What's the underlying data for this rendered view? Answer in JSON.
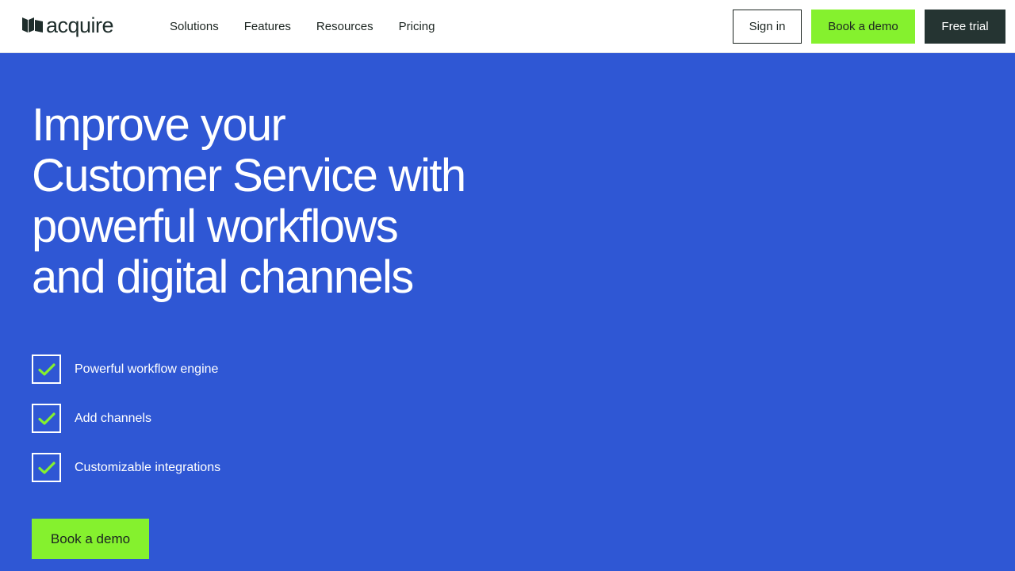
{
  "brand": {
    "name": "acquire",
    "logo_icon": "acquire-flag-logo-icon"
  },
  "nav": {
    "items": [
      {
        "label": "Solutions"
      },
      {
        "label": "Features"
      },
      {
        "label": "Resources"
      },
      {
        "label": "Pricing"
      }
    ]
  },
  "header_actions": {
    "sign_in": "Sign in",
    "book_demo": "Book a demo",
    "free_trial": "Free trial"
  },
  "hero": {
    "headline_lines": [
      "Improve your",
      "Customer Service with",
      "powerful workflows",
      "and digital channels"
    ],
    "features": [
      {
        "label": "Powerful workflow engine",
        "icon": "checkmark-icon",
        "checked": true
      },
      {
        "label": "Add channels",
        "icon": "checkmark-icon",
        "checked": true
      },
      {
        "label": "Customizable integrations",
        "icon": "checkmark-icon",
        "checked": true
      }
    ],
    "cta": "Book a demo"
  },
  "colors": {
    "hero_background": "#2f57d4",
    "accent_green": "#85f12e",
    "dark": "#253432",
    "text_dark": "#1c2521",
    "white": "#ffffff"
  }
}
